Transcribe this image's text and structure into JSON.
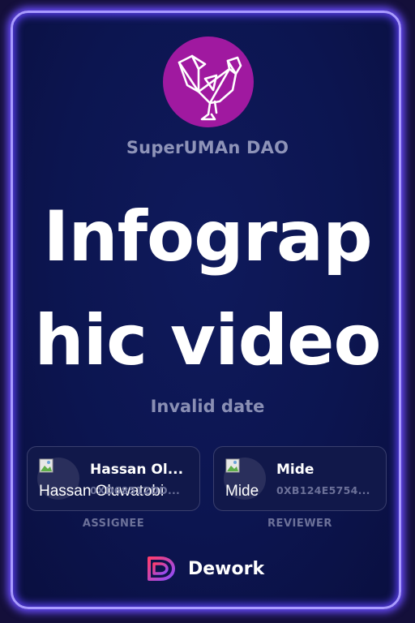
{
  "org": {
    "name": "SuperUMAn DAO",
    "logo_color": "#a019a0",
    "logo_icon": "rooster-icon"
  },
  "task": {
    "title": "Infographic video",
    "date": "Invalid date"
  },
  "assignee": {
    "name": "Hassan Ol...",
    "avatar_alt": "Hassan Oluwatobi",
    "address": "0XD68512DD...",
    "role": "ASSIGNEE"
  },
  "reviewer": {
    "name": "Mide",
    "avatar_alt": "Mide",
    "address": "0XB124E5754...",
    "role": "REVIEWER"
  },
  "brand": {
    "name": "Dework",
    "icon": "dework-logo-icon",
    "accent_colors": [
      "#f43f7a",
      "#7c4dff"
    ]
  },
  "theme": {
    "card_border": "#a99bff",
    "background": "#0c1550"
  }
}
